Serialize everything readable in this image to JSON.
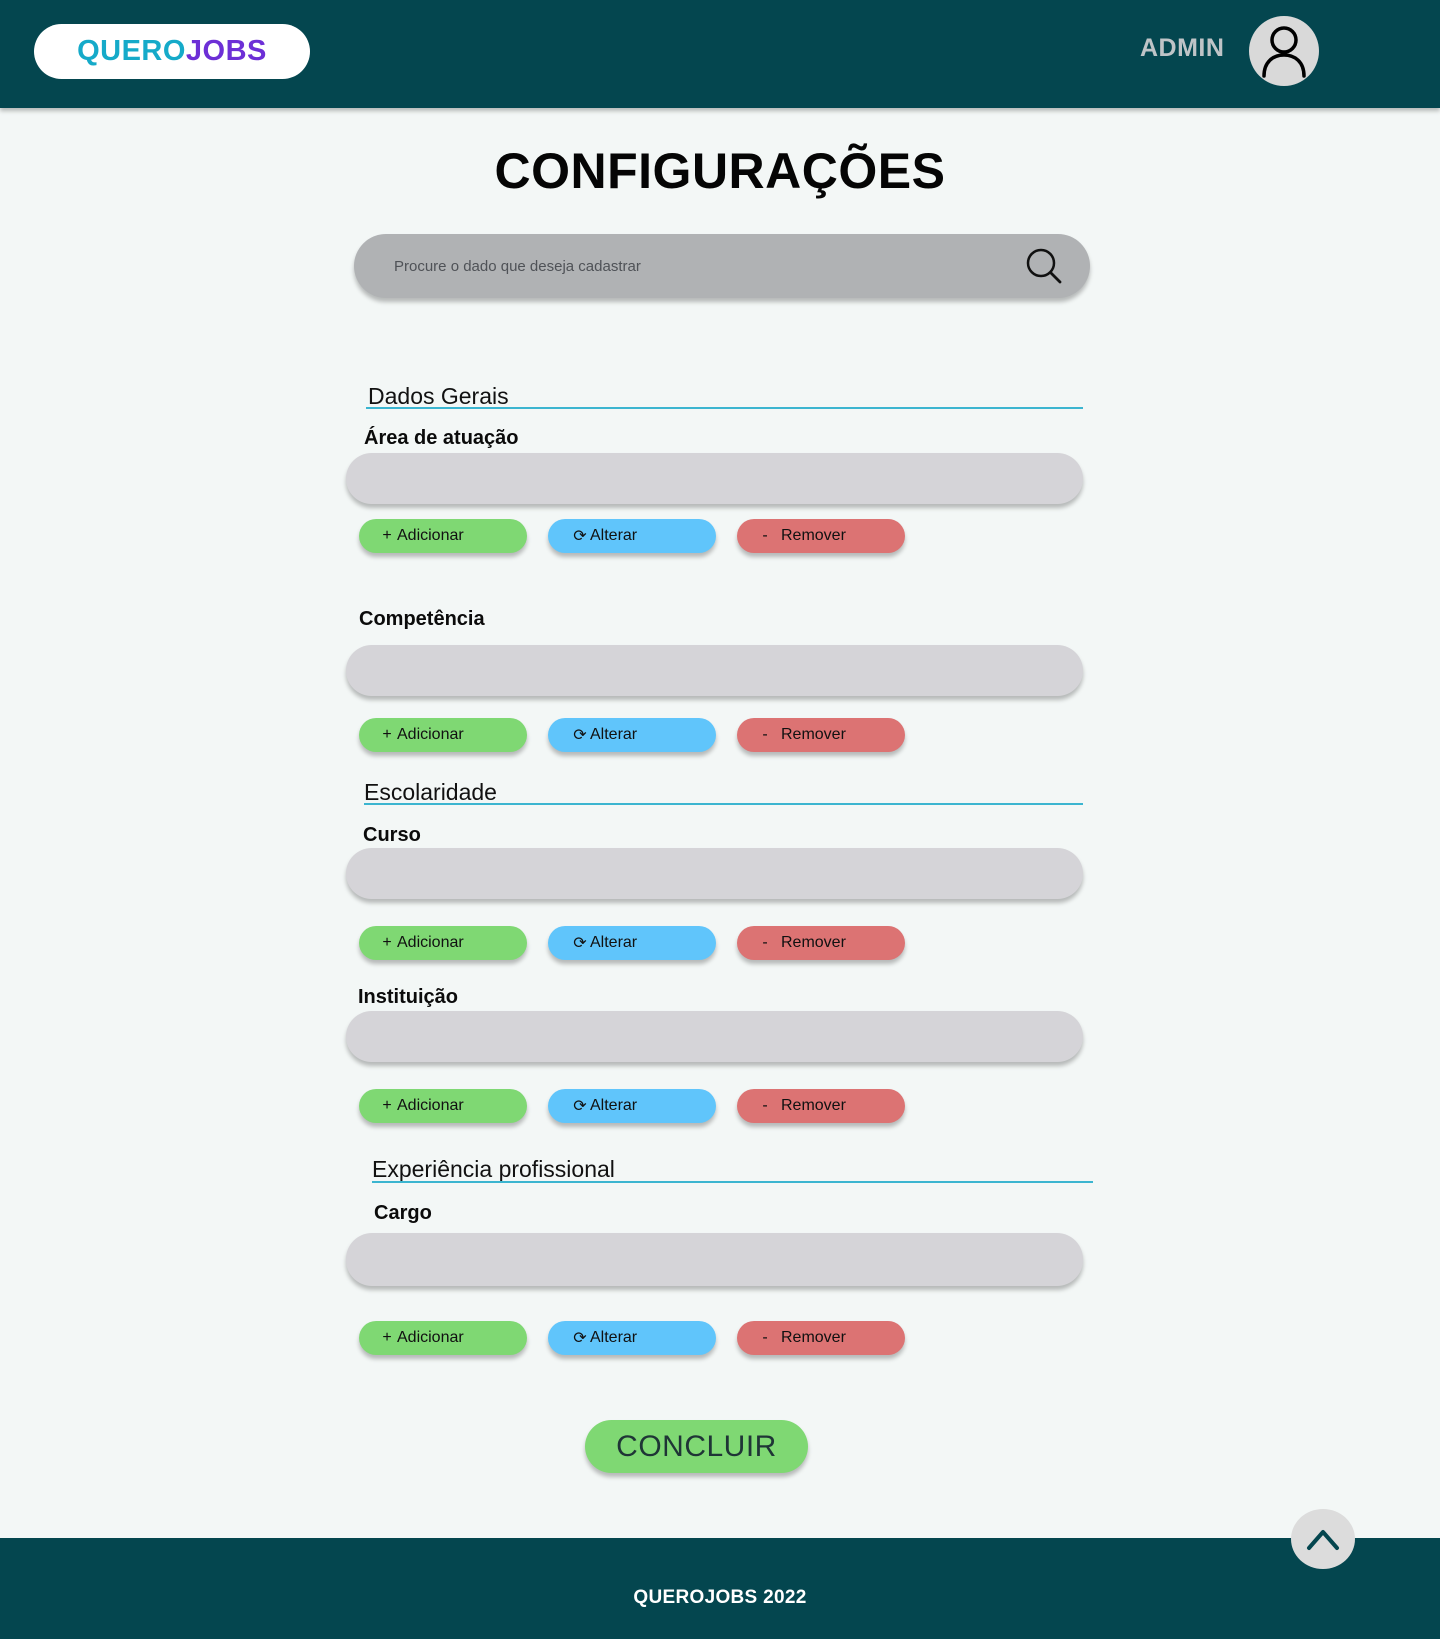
{
  "header": {
    "logo_part1": "QUERO",
    "logo_part2": "JOBS",
    "user_label": "ADMIN",
    "avatar_icon": "user-icon"
  },
  "page_title": "CONFIGURAÇÕES",
  "search": {
    "placeholder": "Procure o dado que deseja cadastrar",
    "icon": "search-icon"
  },
  "buttons": {
    "add_symbol": "+",
    "add_label": "Adicionar",
    "alter_symbol": "⟳",
    "alter_label": "Alterar",
    "remove_symbol": "-",
    "remove_label": "Remover"
  },
  "sections": [
    {
      "title": "Dados Gerais",
      "fields": [
        {
          "label": "Área de atuação",
          "value": ""
        },
        {
          "label": "Competência",
          "value": ""
        }
      ]
    },
    {
      "title": "Escolaridade",
      "fields": [
        {
          "label": "Curso",
          "value": ""
        },
        {
          "label": "Instituição",
          "value": ""
        }
      ]
    },
    {
      "title": "Experiência profissional",
      "fields": [
        {
          "label": "Cargo",
          "value": ""
        }
      ]
    }
  ],
  "conclude_label": "CONCLUIR",
  "footer_text": "QUEROJOBS 2022",
  "colors": {
    "header_bg": "#04464f",
    "add": "#7fd873",
    "alter": "#60c5fb",
    "remove": "#dc7373",
    "logo_cyan": "#15aac9",
    "logo_purple": "#6d2fd6"
  }
}
